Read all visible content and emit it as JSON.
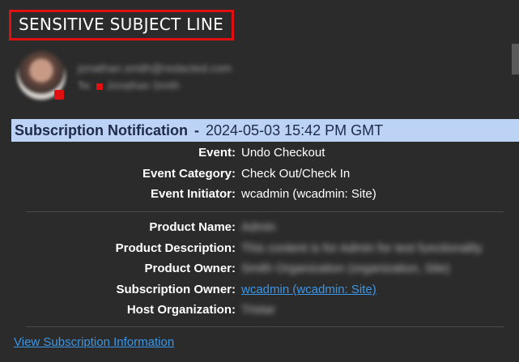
{
  "email": {
    "subject": "SENSITIVE SUBJECT LINE",
    "sender_address": "jonathan.smith@redacted.com",
    "to_label": "To:",
    "to_name": "Jonathan Smith"
  },
  "notification": {
    "title": "Subscription Notification",
    "separator": "-",
    "timestamp": "2024-05-03 15:42 PM GMT",
    "event_fields": [
      {
        "label": "Event:",
        "value": "Undo Checkout"
      },
      {
        "label": "Event Category:",
        "value": "Check Out/Check In"
      },
      {
        "label": "Event Initiator:",
        "value": "wcadmin (wcadmin: Site)"
      }
    ],
    "product_fields": [
      {
        "label": "Product Name:",
        "value": "Admin"
      },
      {
        "label": "Product Description:",
        "value": "This content is for Admin for test functionality"
      },
      {
        "label": "Product Owner:",
        "value": "Smith Organization (organization, Site)"
      },
      {
        "label": "Subscription Owner:",
        "value": "wcadmin (wcadmin: Site)"
      },
      {
        "label": "Host Organization:",
        "value": "Tristar"
      }
    ],
    "view_link": "View Subscription Information"
  },
  "colors": {
    "background": "#2b2b2b",
    "banner": "#bcd3f5",
    "link": "#3b97e8",
    "highlight_border": "#e01010"
  }
}
